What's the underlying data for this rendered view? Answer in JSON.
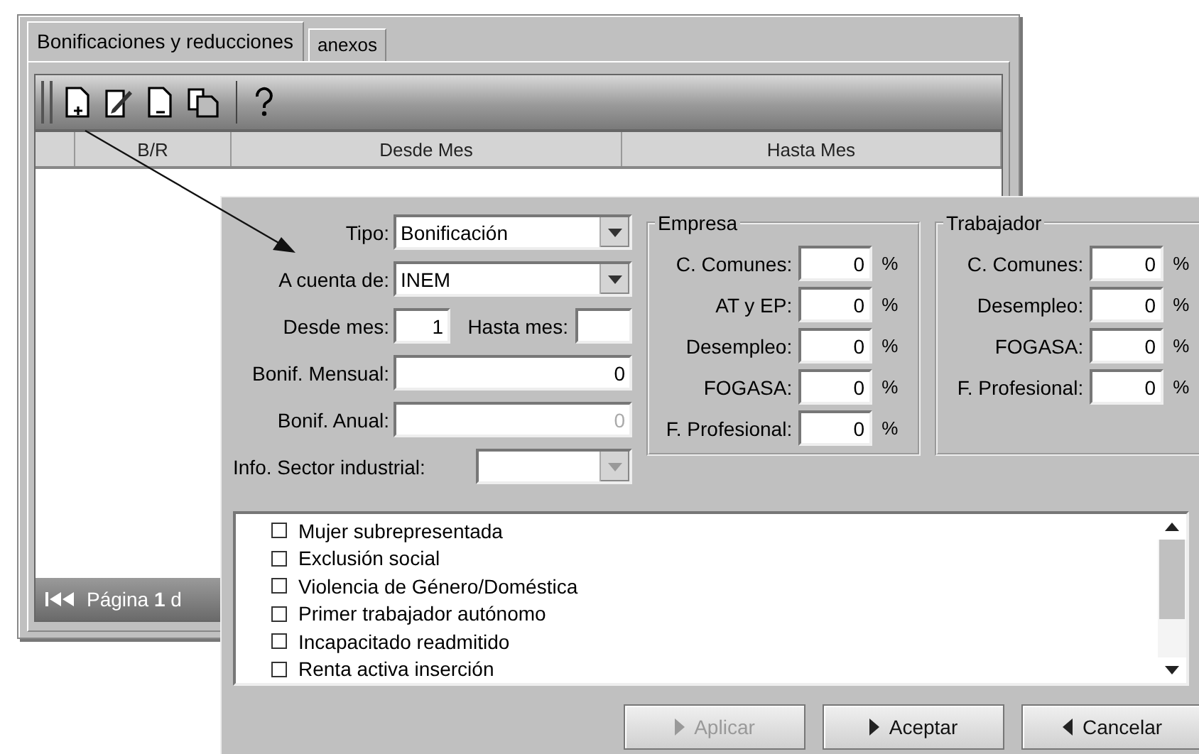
{
  "main_window": {
    "tabs": [
      {
        "label": "Bonificaciones y reducciones",
        "selected": true
      },
      {
        "label": "anexos",
        "selected": false
      }
    ],
    "table": {
      "columns": [
        "B/R",
        "Desde Mes",
        "Hasta Mes"
      ]
    },
    "pager": {
      "label": "Página",
      "page": "1",
      "of": "d"
    }
  },
  "dialog": {
    "form_rows": [
      {
        "kind": "combo",
        "label": "Tipo:",
        "value": "Bonificación",
        "disabled": false
      },
      {
        "kind": "combo",
        "label": "A cuenta de:",
        "value": "INEM",
        "disabled": false
      },
      {
        "kind": "pair",
        "label": "Desde mes:",
        "value": "1",
        "label2": "Hasta mes:"
      },
      {
        "kind": "amount",
        "label": "Bonif. Mensual:",
        "value": "0",
        "disabled": false
      },
      {
        "kind": "amount",
        "label": "Bonif. Anual:",
        "value": "0",
        "disabled": true
      },
      {
        "kind": "wide-combo",
        "label": "Info. Sector industrial:",
        "disabled": true
      }
    ],
    "groups": [
      {
        "title": "Empresa",
        "rows": [
          {
            "label": "C. Comunes:",
            "value": "0",
            "unit": "%"
          },
          {
            "label": "AT y EP:",
            "value": "0",
            "unit": "%"
          },
          {
            "label": "Desempleo:",
            "value": "0",
            "unit": "%"
          },
          {
            "label": "FOGASA:",
            "value": "0",
            "unit": "%"
          },
          {
            "label": "F. Profesional:",
            "value": "0",
            "unit": "%"
          }
        ]
      },
      {
        "title": "Trabajador",
        "rows": [
          {
            "label": "C. Comunes:",
            "value": "0",
            "unit": "%"
          },
          {
            "label": "Desempleo:",
            "value": "0",
            "unit": "%"
          },
          {
            "label": "FOGASA:",
            "value": "0",
            "unit": "%"
          },
          {
            "label": "F. Profesional:",
            "value": "0",
            "unit": "%"
          }
        ]
      }
    ],
    "list": {
      "items": [
        {
          "label": "Mujer subrepresentada",
          "checked": false
        },
        {
          "label": "Exclusión social",
          "checked": false
        },
        {
          "label": "Violencia de Género/Doméstica",
          "checked": false
        },
        {
          "label": "Primer trabajador autónomo",
          "checked": false
        },
        {
          "label": "Incapacitado readmitido",
          "checked": false
        },
        {
          "label": "Renta activa inserción",
          "checked": false
        }
      ]
    },
    "buttons": [
      {
        "label": "Aplicar",
        "kind": "forward",
        "disabled": true
      },
      {
        "label": "Aceptar",
        "kind": "forward",
        "disabled": false
      },
      {
        "label": "Cancelar",
        "kind": "back",
        "disabled": false
      }
    ]
  }
}
